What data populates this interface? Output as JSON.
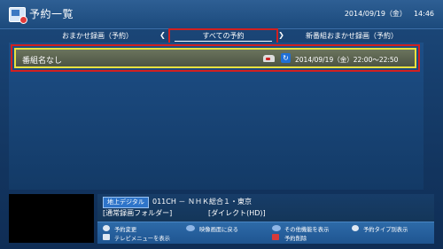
{
  "header": {
    "title": "予約一覧",
    "date": "2014/09/19（金）",
    "time": "14:46",
    "app_icon": "tv-record-icon"
  },
  "tabs": {
    "left": "おまかせ録画（予約）",
    "center": "すべての予約",
    "right": "新番組おまかせ録画（予約）"
  },
  "list": {
    "rows": [
      {
        "title": "番組名なし",
        "rec_icon": "recorder-icon",
        "repeat_icon": "repeat-icon",
        "datetime": "2014/09/19（金）22:00～22:50"
      }
    ]
  },
  "info": {
    "broadcast_badge": "地上デジタル",
    "channel": "011CH － ＮＨＫ総合１・東京",
    "folder": "[通常録画フォルダー]",
    "source": "[ダイレクト(HD)]"
  },
  "help": {
    "change": "予約変更",
    "back": "映像画面に戻る",
    "other": "その他機能を表示",
    "type": "予約タイプ別表示",
    "tvmenu": "テレビメニューを表示",
    "delete": "予約削除"
  },
  "colors": {
    "highlight_red": "#d12020",
    "selected_yellow": "#e8e240",
    "accent_blue": "#2e74c9"
  }
}
